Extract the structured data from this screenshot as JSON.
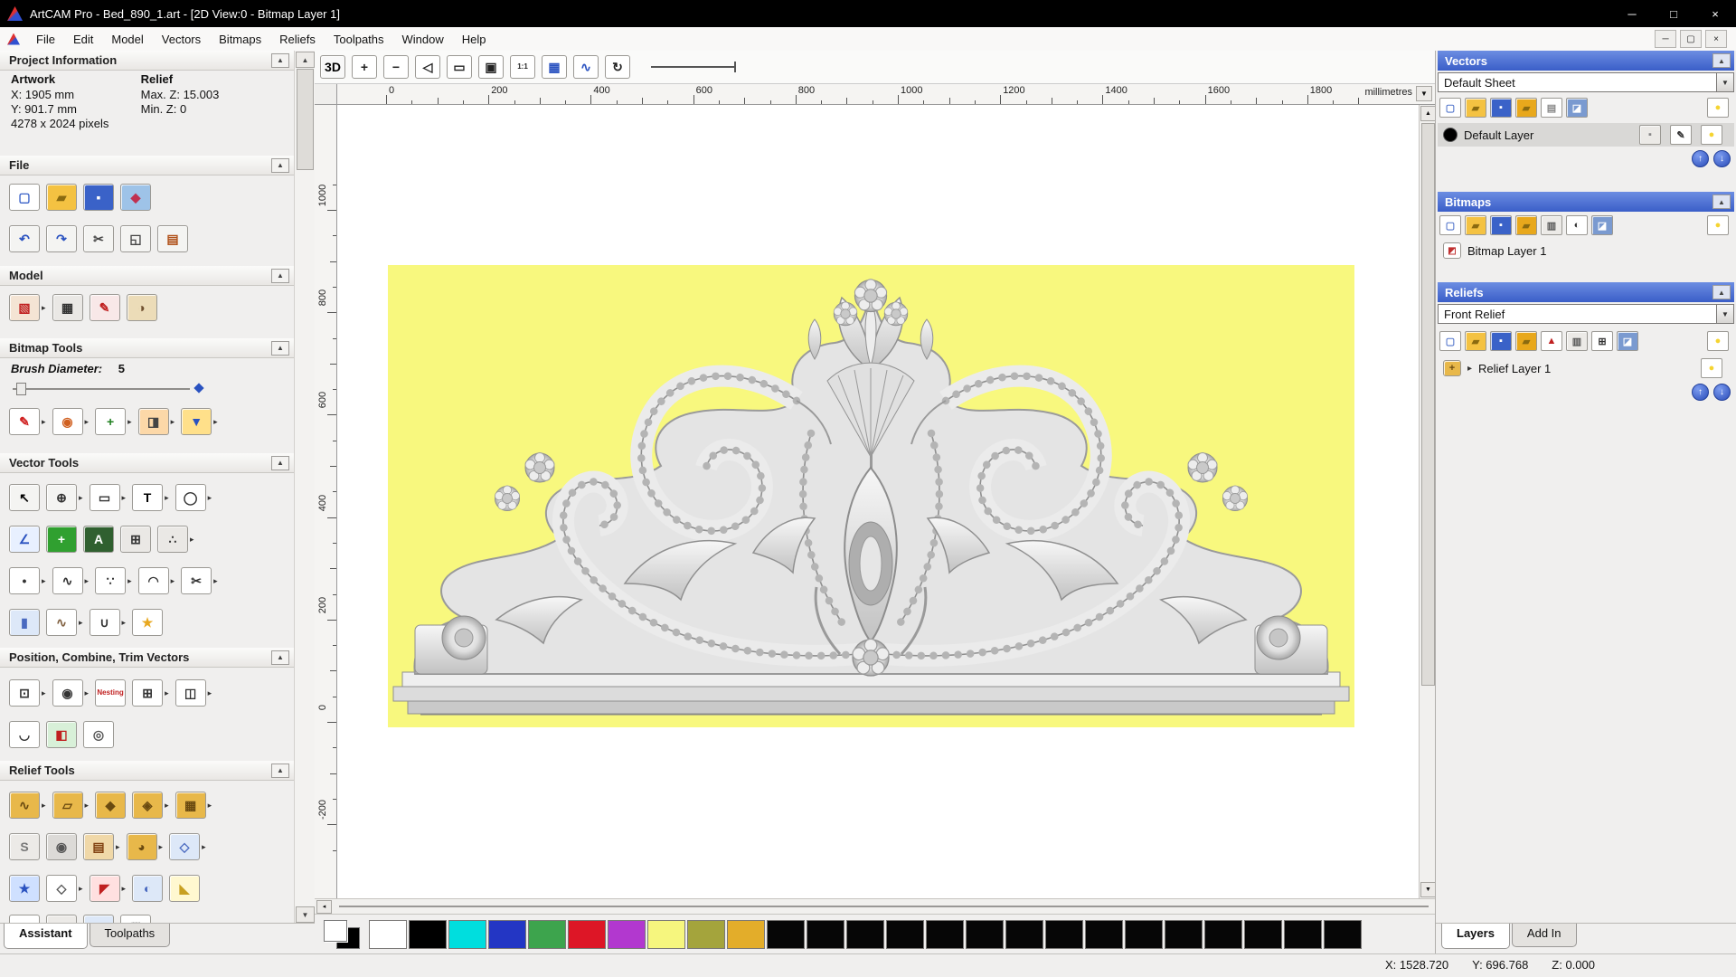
{
  "window": {
    "title": "ArtCAM Pro - Bed_890_1.art - [2D View:0 - Bitmap Layer 1]",
    "controls": {
      "minimize": "─",
      "maximize": "□",
      "close": "×"
    },
    "child_controls": {
      "minimize": "─",
      "restore": "▢",
      "close": "×"
    }
  },
  "menu": {
    "items": [
      "File",
      "Edit",
      "Model",
      "Vectors",
      "Bitmaps",
      "Reliefs",
      "Toolpaths",
      "Window",
      "Help"
    ]
  },
  "left_panel": {
    "project_info": {
      "header": "Project Information",
      "artwork_heading": "Artwork",
      "relief_heading": "Relief",
      "artwork_x": "X: 1905 mm",
      "artwork_y": "Y: 901.7 mm",
      "relief_max_z": "Max. Z: 15.003",
      "relief_min_z": "Min. Z: 0",
      "artwork_pixels": "4278 x 2024 pixels"
    },
    "file_section": {
      "header": "File",
      "row1": [
        [
          "new-model",
          "▢",
          "#3a62c8",
          "#ffffff",
          0
        ],
        [
          "open-model",
          "▰",
          "#8a6a10",
          "#f4c242",
          0
        ],
        [
          "save-model",
          "▪",
          "#ffffff",
          "#3a62c8",
          0
        ],
        [
          "import-3d-model",
          "◆",
          "#c03050",
          "#9ec3e8",
          0
        ]
      ],
      "row2": [
        [
          "undo",
          "↶",
          "#2a52c0",
          "#f4f4f2",
          0
        ],
        [
          "redo",
          "↷",
          "#2a52c0",
          "#f4f4f2",
          0
        ],
        [
          "cut",
          "✂",
          "#444444",
          "#f4f4f2",
          0
        ],
        [
          "copy",
          "◱",
          "#444444",
          "#f4f4f2",
          0
        ],
        [
          "paste",
          "▤",
          "#b05018",
          "#f4f4f2",
          0
        ]
      ]
    },
    "model_section": {
      "header": "Model",
      "row1": [
        [
          "set-model-size",
          "▧",
          "#c02020",
          "#f4e4d4",
          1
        ],
        [
          "set-model-position",
          "▦",
          "#333333",
          "#eae8e5",
          0
        ],
        [
          "paint-relief",
          "✎",
          "#c02020",
          "#f8e8e8",
          0
        ],
        [
          "adjust-model-lighting",
          "◑",
          "#705030",
          "#ecdcb8",
          0
        ]
      ]
    },
    "bitmap_section": {
      "header": "Bitmap Tools",
      "brush_label": "Brush Diameter:",
      "brush_value": "5",
      "row1": [
        [
          "paint-brush",
          "✎",
          "#d02020",
          "#ffffff",
          1
        ],
        [
          "paint-selective",
          "◉",
          "#d06020",
          "#ffffff",
          1
        ],
        [
          "colour-picker",
          "+",
          "#208020",
          "#ffffff",
          1
        ],
        [
          "edit-colours",
          "◨",
          "#444444",
          "#fcd8a8",
          1
        ],
        [
          "flood-fill",
          "▼",
          "#2a52c0",
          "#ffe08a",
          1
        ]
      ]
    },
    "vector_section": {
      "header": "Vector Tools",
      "rows": [
        [
          [
            "select-vectors",
            "↖",
            "#000000",
            "#f4f4f2",
            0
          ],
          [
            "transform-vectors",
            "⊕",
            "#333333",
            "#f4f4f2",
            1
          ],
          [
            "create-rectangle",
            "▭",
            "#333333",
            "#ffffff",
            1
          ],
          [
            "create-text",
            "T",
            "#000000",
            "#ffffff",
            1
          ],
          [
            "create-ellipse",
            "◯",
            "#333333",
            "#ffffff",
            1
          ]
        ],
        [
          [
            "measure-tool",
            "∠",
            "#2a52c0",
            "#e8f0ff",
            0
          ],
          [
            "vector-doctor",
            "+",
            "#ffffff",
            "#30a030",
            0
          ],
          [
            "text-in-a-box",
            "A",
            "#ffffff",
            "#306030",
            0
          ],
          [
            "create-grid",
            "⊞",
            "#333333",
            "#eae8e5",
            0
          ],
          [
            "snap-points",
            "∴",
            "#333333",
            "#eae8e5",
            1
          ]
        ],
        [
          [
            "create-point",
            "•",
            "#333333",
            "#ffffff",
            1
          ],
          [
            "freehand-curve",
            "∿",
            "#333333",
            "#ffffff",
            1
          ],
          [
            "node-editing",
            "∵",
            "#333333",
            "#ffffff",
            1
          ],
          [
            "create-arc",
            "◠",
            "#333333",
            "#ffffff",
            1
          ],
          [
            "trim-vectors",
            "✂",
            "#333333",
            "#ffffff",
            1
          ]
        ],
        [
          [
            "create-cylinder",
            "▮",
            "#4a6ac0",
            "#dde8f8",
            0
          ],
          [
            "fit-curve",
            "∿",
            "#806040",
            "#ffffff",
            1
          ],
          [
            "join-vectors",
            "∪",
            "#333333",
            "#ffffff",
            1
          ],
          [
            "create-star",
            "★",
            "#e8a820",
            "#ffffff",
            0
          ]
        ]
      ]
    },
    "position_section": {
      "header": "Position, Combine, Trim Vectors",
      "rows": [
        [
          [
            "block-centre-align",
            "⊡",
            "#333333",
            "#ffffff",
            1
          ],
          [
            "circular-copy",
            "◉",
            "#333333",
            "#ffffff",
            1
          ],
          [
            "nesting",
            "Nesting",
            "#c02020",
            "#ffffff",
            0
          ],
          [
            "block-copy",
            "⊞",
            "#333333",
            "#ffffff",
            1
          ],
          [
            "weld-vectors",
            "◫",
            "#333333",
            "#ffffff",
            1
          ]
        ],
        [
          [
            "fillet-tool",
            "◡",
            "#333333",
            "#ffffff",
            0
          ],
          [
            "clip-vectors",
            "◧",
            "#c02020",
            "#d8f0d8",
            0
          ],
          [
            "create-spiral",
            "◎",
            "#555555",
            "#ffffff",
            0
          ]
        ]
      ]
    },
    "relief_section": {
      "header": "Relief Tools",
      "rows": [
        [
          [
            "sculpting",
            "∿",
            "#6a4a10",
            "#e8b84a",
            1
          ],
          [
            "smooth-relief",
            "▱",
            "#6a4a10",
            "#e8b84a",
            1
          ],
          [
            "shape-editor",
            "◆",
            "#6a4a10",
            "#e8b84a",
            0
          ],
          [
            "emboss-wizard",
            "◈",
            "#6a4a10",
            "#e8b84a",
            1
          ],
          [
            "texture-wizard",
            "▦",
            "#6a4a10",
            "#e8b84a",
            1
          ]
        ],
        [
          [
            "smoothing",
            "S",
            "#777777",
            "#eceae7",
            0
          ],
          [
            "weave-wizard",
            "◉",
            "#555555",
            "#dcdad7",
            0
          ],
          [
            "clipart-library",
            "▤",
            "#804010",
            "#f0d8a8",
            1
          ],
          [
            "face-wizard",
            "◕",
            "#6a4a10",
            "#e8b84a",
            1
          ],
          [
            "envelope-distortion",
            "◇",
            "#4a6ac0",
            "#dde8f8",
            1
          ]
        ],
        [
          [
            "two-rail-sweep",
            "★",
            "#2a52c0",
            "#cfe0ff",
            0
          ],
          [
            "extrude-relief",
            "◇",
            "#555555",
            "#ffffff",
            1
          ],
          [
            "turn-relief",
            "◤",
            "#c02020",
            "#ffe0e0",
            1
          ],
          [
            "texture-sphere",
            "◐",
            "#4a6ac0",
            "#dde8f8",
            0
          ],
          [
            "angled-plane",
            "◣",
            "#c8a020",
            "#fff8d0",
            0
          ]
        ],
        [
          [
            "offset-relief",
            "▲",
            "#c02020",
            "#ffffff",
            0
          ],
          [
            "mirror-relief",
            "▥",
            "#555555",
            "#eceae7",
            0
          ],
          [
            "create-sphere",
            "●",
            "#4a6ac0",
            "#dde8f8",
            0
          ],
          [
            "smooth-mask",
            "▒",
            "#888888",
            "#ffffff",
            0
          ]
        ]
      ]
    },
    "tabs": [
      {
        "label": "Assistant",
        "active": true
      },
      {
        "label": "Toolpaths",
        "active": false
      }
    ]
  },
  "canvas": {
    "artwork_bg": "#f8f87e",
    "toolbar": [
      [
        "view-3d",
        "3D",
        "#000000",
        "#f8f8f8",
        0
      ],
      [
        "zoom-in",
        "+",
        "#222222",
        "#ffffff",
        0
      ],
      [
        "zoom-out",
        "−",
        "#222222",
        "#ffffff",
        0
      ],
      [
        "zoom-previous",
        "◁",
        "#222222",
        "#ffffff",
        0
      ],
      [
        "zoom-window",
        "▭",
        "#222222",
        "#ffffff",
        0
      ],
      [
        "zoom-fit",
        "▣",
        "#222222",
        "#ffffff",
        0
      ],
      [
        "zoom-1to1",
        "1:1",
        "#222222",
        "#ffffff",
        0
      ],
      [
        "toggle-bitmap-visibility",
        "▦",
        "#2a52c0",
        "#ffffff",
        0
      ],
      [
        "toggle-vector-visibility",
        "∿",
        "#2a52c0",
        "#ffffff",
        0
      ],
      [
        "refresh-view",
        "↻",
        "#222222",
        "#ffffff",
        0
      ]
    ],
    "ruler": {
      "unit": "millimetres",
      "h_ticks": [
        0,
        200,
        400,
        600,
        800,
        1000,
        1200,
        1400,
        1600,
        1800
      ],
      "v_ticks": [
        1000,
        800,
        600,
        400,
        200,
        0,
        -200
      ]
    }
  },
  "right_panel": {
    "vectors": {
      "title": "Vectors",
      "sheet_value": "Default Sheet",
      "toolbar": [
        [
          "new-vector-sheet",
          "▢",
          "#5577cc",
          "#ffffff",
          0
        ],
        [
          "open-vector-layer",
          "▰",
          "#8a6a10",
          "#f4c242",
          0
        ],
        [
          "save-vector-layer",
          "▪",
          "#ffffff",
          "#3a62c8",
          0
        ],
        [
          "import-vector-layer",
          "▰",
          "#8a6a10",
          "#e8a81c",
          0
        ],
        [
          "new-vector-layer",
          "▤",
          "#888888",
          "#ffffff",
          0
        ],
        [
          "delete-vector-layer",
          "◪",
          "#ffffff",
          "#7a9ad0",
          0
        ]
      ],
      "toolbar_right": [
        [
          "toggle-all-vector-visibility",
          "●",
          "#f5d431",
          "#ffffff",
          0
        ]
      ],
      "layer_name": "Default Layer",
      "layer_buttons": [
        [
          "lock-layer",
          "▪",
          "#888888",
          "#eceae7",
          0
        ],
        [
          "edit-layer",
          "✎",
          "#333333",
          "#ffffff",
          0
        ],
        [
          "layer-visibility",
          "●",
          "#f5d431",
          "#ffffff",
          0
        ]
      ]
    },
    "bitmaps": {
      "title": "Bitmaps",
      "toolbar": [
        [
          "new-bitmap-layer",
          "▢",
          "#5577cc",
          "#ffffff",
          0
        ],
        [
          "open-bitmap-layer",
          "▰",
          "#8a6a10",
          "#f4c242",
          0
        ],
        [
          "save-bitmap-layer",
          "▪",
          "#ffffff",
          "#3a62c8",
          0
        ],
        [
          "import-bitmap-layer",
          "▰",
          "#8a6a10",
          "#e8a81c",
          0
        ],
        [
          "merge-bitmap-layers",
          "▥",
          "#555555",
          "#eceae7",
          0
        ],
        [
          "bitmap-contrast",
          "◐",
          "#333333",
          "#ffffff",
          0
        ],
        [
          "delete-bitmap-layer",
          "◪",
          "#ffffff",
          "#7a9ad0",
          0
        ]
      ],
      "toolbar_right": [
        [
          "toggle-all-bitmap-visibility",
          "●",
          "#f5d431",
          "#ffffff",
          0
        ]
      ],
      "layer_name": "Bitmap Layer 1"
    },
    "reliefs": {
      "title": "Reliefs",
      "selected_value": "Front Relief",
      "toolbar": [
        [
          "new-relief-layer",
          "▢",
          "#5577cc",
          "#ffffff",
          0
        ],
        [
          "open-relief-layer",
          "▰",
          "#8a6a10",
          "#f4c242",
          0
        ],
        [
          "save-relief-layer",
          "▪",
          "#ffffff",
          "#3a62c8",
          0
        ],
        [
          "import-relief-layer",
          "▰",
          "#8a6a10",
          "#e8a81c",
          0
        ],
        [
          "relief-front-back",
          "▲",
          "#c02020",
          "#ffffff",
          0
        ],
        [
          "merge-relief-layers",
          "▥",
          "#555555",
          "#eceae7",
          0
        ],
        [
          "combine-relief-layers",
          "⊞",
          "#333333",
          "#ffffff",
          0
        ],
        [
          "delete-relief-layer",
          "◪",
          "#ffffff",
          "#7a9ad0",
          0
        ]
      ],
      "toolbar_right": [
        [
          "toggle-all-relief-visibility",
          "●",
          "#f5d431",
          "#ffffff",
          0
        ]
      ],
      "layer_name": "Relief Layer 1",
      "layer_buttons": [
        [
          "relief-layer-visibility",
          "●",
          "#f5d431",
          "#ffffff",
          0
        ]
      ]
    },
    "tabs": [
      {
        "label": "Layers",
        "active": true
      },
      {
        "label": "Add In",
        "active": false
      }
    ]
  },
  "palette": {
    "primary": "#ffffff",
    "secondary": "#000000",
    "swatches": [
      [
        "white",
        "#ffffff"
      ],
      [
        "black",
        "#000000"
      ],
      [
        "cyan",
        "#00dede"
      ],
      [
        "blue",
        "#2336c4"
      ],
      [
        "green",
        "#3da44d"
      ],
      [
        "red",
        "#dd1626"
      ],
      [
        "magenta",
        "#b238cf"
      ],
      [
        "pale-yellow",
        "#f6f67e"
      ],
      [
        "olive",
        "#a4a43c"
      ],
      [
        "gold",
        "#e3ad2a"
      ],
      [
        "black-2",
        "#060606"
      ],
      [
        "black-3",
        "#060606"
      ],
      [
        "black-4",
        "#060606"
      ],
      [
        "black-5",
        "#060606"
      ],
      [
        "black-6",
        "#060606"
      ],
      [
        "black-7",
        "#060606"
      ],
      [
        "black-8",
        "#060606"
      ],
      [
        "black-9",
        "#060606"
      ],
      [
        "black-10",
        "#060606"
      ],
      [
        "black-11",
        "#060606"
      ],
      [
        "black-12",
        "#060606"
      ],
      [
        "black-13",
        "#060606"
      ],
      [
        "black-14",
        "#060606"
      ],
      [
        "black-15",
        "#060606"
      ],
      [
        "black-16",
        "#060606"
      ]
    ]
  },
  "status_bar": {
    "x": "X: 1528.720",
    "y": "Y: 696.768",
    "z": "Z: 0.000"
  }
}
